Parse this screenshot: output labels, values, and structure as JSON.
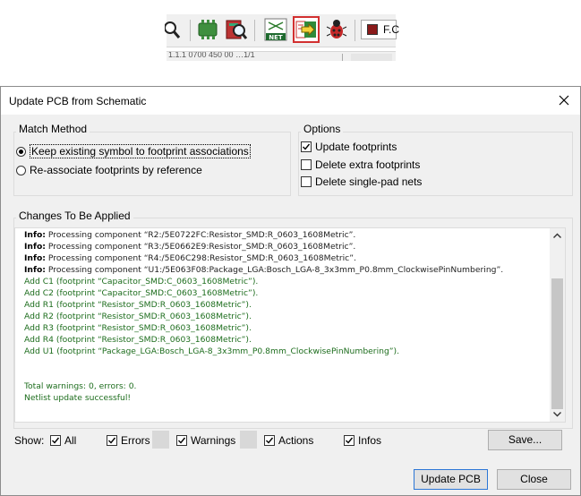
{
  "toolbar": {
    "icons": [
      "zoom-area-icon",
      "footprint-editor-icon",
      "footprint-browser-icon",
      "netlist-icon",
      "update-pcb-icon",
      "drc-icon"
    ],
    "layer_label": "F.C",
    "layer_color": "#8a1a1a",
    "status_text": "1.1.1 0700  450 00 …1/1"
  },
  "dialog": {
    "title": "Update PCB from Schematic",
    "match_method": {
      "label": "Match Method",
      "options": [
        {
          "label": "Keep existing symbol to footprint associations",
          "selected": true
        },
        {
          "label": "Re-associate footprints by reference",
          "selected": false
        }
      ]
    },
    "options": {
      "label": "Options",
      "items": [
        {
          "label": "Update footprints",
          "checked": true
        },
        {
          "label": "Delete extra footprints",
          "checked": false
        },
        {
          "label": "Delete single-pad nets",
          "checked": false
        }
      ]
    },
    "changes": {
      "label": "Changes To Be Applied",
      "lines": [
        {
          "type": "info",
          "prefix": "Info:",
          "text": " Processing component “R2:/5E0722FC:Resistor_SMD:R_0603_1608Metric”."
        },
        {
          "type": "info",
          "prefix": "Info:",
          "text": " Processing component “R3:/5E0662E9:Resistor_SMD:R_0603_1608Metric”."
        },
        {
          "type": "info",
          "prefix": "Info:",
          "text": " Processing component “R4:/5E06C298:Resistor_SMD:R_0603_1608Metric”."
        },
        {
          "type": "info",
          "prefix": "Info:",
          "text": " Processing component “U1:/5E063F08:Package_LGA:Bosch_LGA-8_3x3mm_P0.8mm_ClockwisePinNumbering”."
        },
        {
          "type": "action",
          "prefix": "",
          "text": "Add C1 (footprint “Capacitor_SMD:C_0603_1608Metric”)."
        },
        {
          "type": "action",
          "prefix": "",
          "text": "Add C2 (footprint “Capacitor_SMD:C_0603_1608Metric”)."
        },
        {
          "type": "action",
          "prefix": "",
          "text": "Add R1 (footprint “Resistor_SMD:R_0603_1608Metric”)."
        },
        {
          "type": "action",
          "prefix": "",
          "text": "Add R2 (footprint “Resistor_SMD:R_0603_1608Metric”)."
        },
        {
          "type": "action",
          "prefix": "",
          "text": "Add R3 (footprint “Resistor_SMD:R_0603_1608Metric”)."
        },
        {
          "type": "action",
          "prefix": "",
          "text": "Add R4 (footprint “Resistor_SMD:R_0603_1608Metric”)."
        },
        {
          "type": "action",
          "prefix": "",
          "text": "Add U1 (footprint “Package_LGA:Bosch_LGA-8_3x3mm_P0.8mm_ClockwisePinNumbering”)."
        },
        {
          "type": "blank",
          "prefix": "",
          "text": ""
        },
        {
          "type": "blank",
          "prefix": "",
          "text": ""
        },
        {
          "type": "action",
          "prefix": "",
          "text": "Total warnings: 0, errors: 0."
        },
        {
          "type": "action",
          "prefix": "",
          "text": "Netlist update successful!"
        }
      ]
    },
    "filters": {
      "show_label": "Show:",
      "all": {
        "label": "All",
        "checked": true
      },
      "errors": {
        "label": "Errors",
        "checked": true
      },
      "warnings": {
        "label": "Warnings",
        "checked": true
      },
      "actions": {
        "label": "Actions",
        "checked": true
      },
      "infos": {
        "label": "Infos",
        "checked": true
      }
    },
    "buttons": {
      "save": "Save...",
      "update": "Update PCB",
      "close": "Close"
    }
  }
}
